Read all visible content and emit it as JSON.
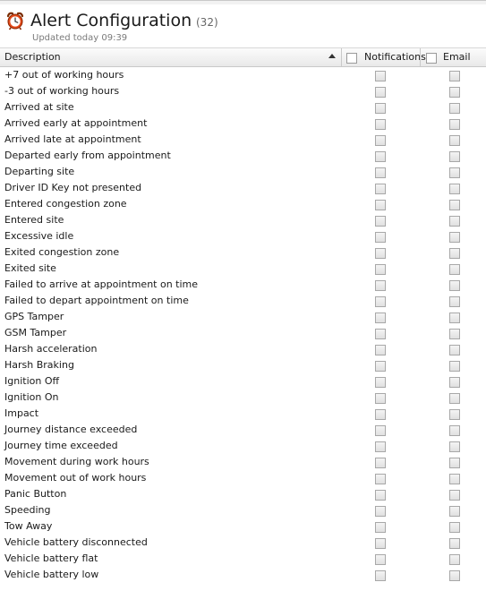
{
  "header": {
    "icon": "alarm-clock-icon",
    "title": "Alert Configuration",
    "count": "(32)",
    "updated": "Updated today 09:39"
  },
  "columns": {
    "description": "Description",
    "notifications": "Notifications",
    "email": "Email",
    "sort_direction": "ascending"
  },
  "alerts": [
    {
      "label": "+7 out of working hours",
      "notifications": false,
      "email": false
    },
    {
      "label": "-3 out of working hours",
      "notifications": false,
      "email": false
    },
    {
      "label": "Arrived at site",
      "notifications": false,
      "email": false
    },
    {
      "label": "Arrived early at appointment",
      "notifications": false,
      "email": false
    },
    {
      "label": "Arrived late at appointment",
      "notifications": false,
      "email": false
    },
    {
      "label": "Departed early from appointment",
      "notifications": false,
      "email": false
    },
    {
      "label": "Departing site",
      "notifications": false,
      "email": false
    },
    {
      "label": "Driver ID Key not presented",
      "notifications": false,
      "email": false
    },
    {
      "label": "Entered congestion zone",
      "notifications": false,
      "email": false
    },
    {
      "label": "Entered site",
      "notifications": false,
      "email": false
    },
    {
      "label": "Excessive idle",
      "notifications": false,
      "email": false
    },
    {
      "label": "Exited congestion zone",
      "notifications": false,
      "email": false
    },
    {
      "label": "Exited site",
      "notifications": false,
      "email": false
    },
    {
      "label": "Failed to arrive at appointment on time",
      "notifications": false,
      "email": false
    },
    {
      "label": "Failed to depart appointment on time",
      "notifications": false,
      "email": false
    },
    {
      "label": "GPS Tamper",
      "notifications": false,
      "email": false
    },
    {
      "label": "GSM Tamper",
      "notifications": false,
      "email": false
    },
    {
      "label": "Harsh acceleration",
      "notifications": false,
      "email": false
    },
    {
      "label": "Harsh Braking",
      "notifications": false,
      "email": false
    },
    {
      "label": "Ignition Off",
      "notifications": false,
      "email": false
    },
    {
      "label": "Ignition On",
      "notifications": false,
      "email": false
    },
    {
      "label": "Impact",
      "notifications": false,
      "email": false
    },
    {
      "label": "Journey distance exceeded",
      "notifications": false,
      "email": false
    },
    {
      "label": "Journey time exceeded",
      "notifications": false,
      "email": false
    },
    {
      "label": "Movement during work hours",
      "notifications": false,
      "email": false
    },
    {
      "label": "Movement out of work hours",
      "notifications": false,
      "email": false
    },
    {
      "label": "Panic Button",
      "notifications": false,
      "email": false
    },
    {
      "label": "Speeding",
      "notifications": false,
      "email": false
    },
    {
      "label": "Tow Away",
      "notifications": false,
      "email": false
    },
    {
      "label": "Vehicle battery disconnected",
      "notifications": false,
      "email": false
    },
    {
      "label": "Vehicle battery flat",
      "notifications": false,
      "email": false
    },
    {
      "label": "Vehicle battery low",
      "notifications": false,
      "email": false
    }
  ]
}
